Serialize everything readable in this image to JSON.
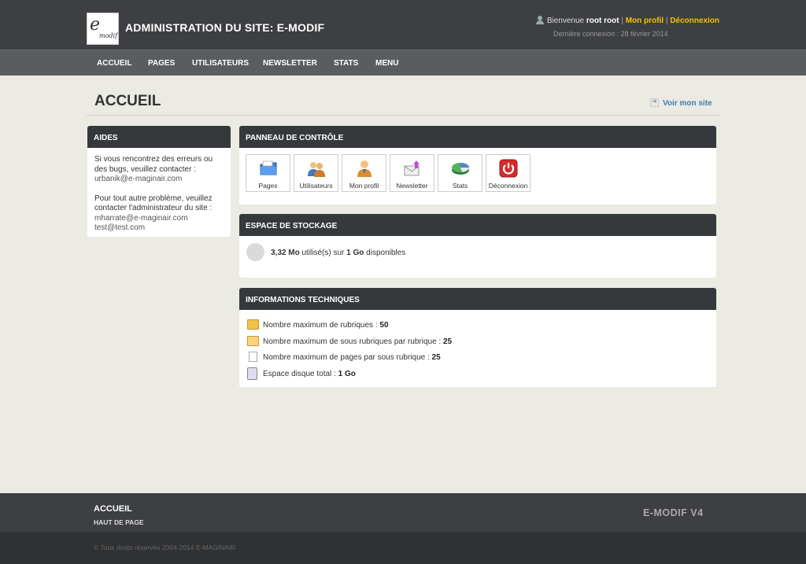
{
  "header": {
    "logo_letter": "e",
    "logo_word": "modif",
    "title": "ADMINISTRATION DU SITE: E-MODIF",
    "welcome_prefix": "Bienvenue",
    "user_name": "root root",
    "separator": "|",
    "profile_link": "Mon profil",
    "logout_link": "Déconnexion",
    "last_login": "Dernière connexion : 28 février 2014"
  },
  "nav": {
    "items": [
      "ACCUEIL",
      "PAGES",
      "UTILISATEURS",
      "NEWSLETTER",
      "STATS",
      "MENU"
    ]
  },
  "page": {
    "title": "ACCUEIL",
    "view_site": "Voir mon site"
  },
  "aides": {
    "heading": "AIDES",
    "text1": "Si vous rencontrez des erreurs ou des bugs, veuillez contacter :",
    "email1": "urbanik@e-maginair.com",
    "text2": "Pour tout autre problème, veuillez contacter l'administrateur du site :",
    "email2": "mharrate@e-maginair.com",
    "email3": "test@test.com"
  },
  "control_panel": {
    "heading": "PANNEAU DE CONTRÔLE",
    "tiles": [
      {
        "label": "Pages",
        "icon": "folder-icon"
      },
      {
        "label": "Utilisateurs",
        "icon": "users-icon"
      },
      {
        "label": "Mon profil",
        "icon": "user-icon"
      },
      {
        "label": "Newsletter",
        "icon": "envelope-icon"
      },
      {
        "label": "Stats",
        "icon": "pie-chart-icon"
      },
      {
        "label": "Déconnexion",
        "icon": "power-icon"
      }
    ]
  },
  "storage": {
    "heading": "ESPACE DE STOCKAGE",
    "used": "3,32 Mo",
    "used_text": "utilisé(s) sur",
    "total": "1 Go",
    "available_text": "disponibles"
  },
  "tech_info": {
    "heading": "INFORMATIONS TECHNIQUES",
    "rows": [
      {
        "label": "Nombre maximum de rubriques :",
        "value": "50",
        "icon": "folder-icon"
      },
      {
        "label": "Nombre maximum de sous rubriques par rubrique :",
        "value": "25",
        "icon": "folder-open-icon"
      },
      {
        "label": "Nombre maximum de pages par sous rubrique :",
        "value": "25",
        "icon": "document-icon"
      },
      {
        "label": "Espace disque total :",
        "value": "1 Go",
        "icon": "disk-icon"
      }
    ]
  },
  "footer": {
    "title": "ACCUEIL",
    "top_link": "HAUT DE PAGE",
    "version": "E-MODIF V4",
    "copyright": "© Tous droits réservés 2004-2014 E-MAGINAIR"
  }
}
